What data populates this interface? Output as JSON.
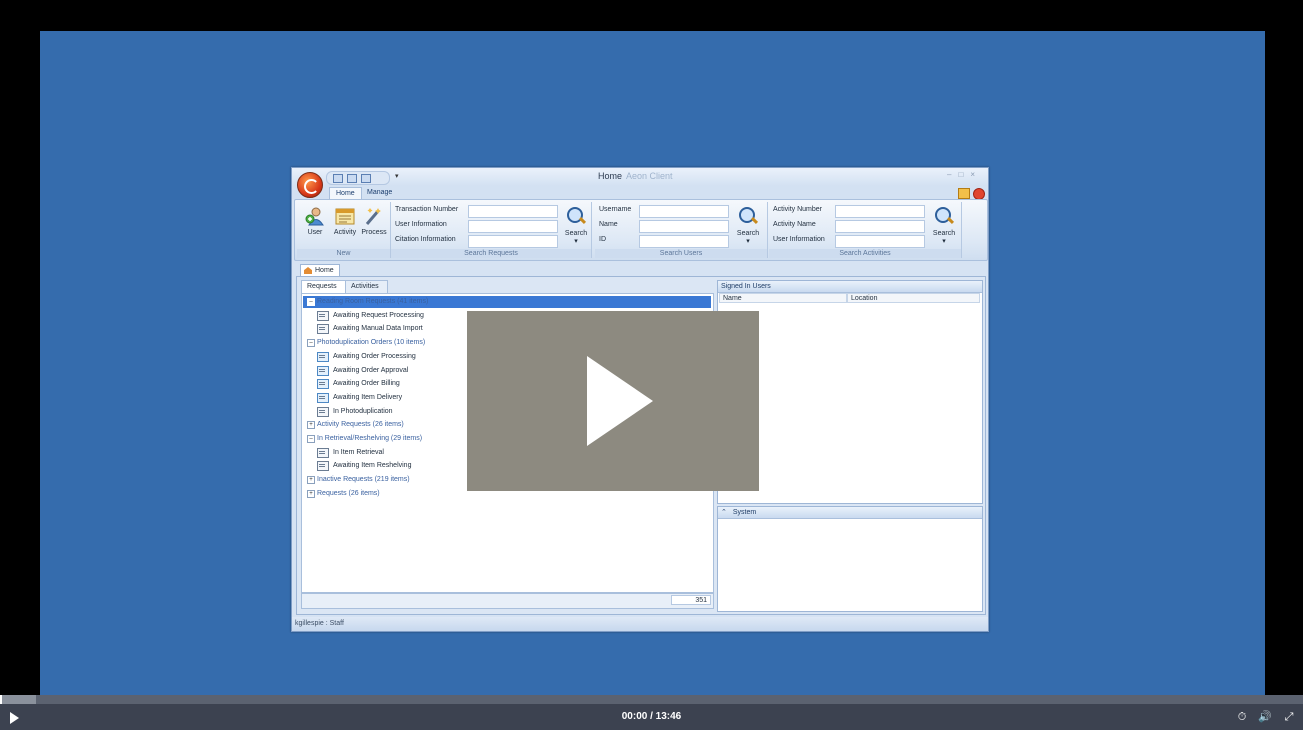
{
  "window": {
    "title": "Home",
    "title_sub": "Aeon Client",
    "ribbon_tabs": [
      "Home",
      "Manage"
    ]
  },
  "ribbon": {
    "new_group": {
      "caption": "New",
      "buttons": [
        "User",
        "Activity",
        "Process"
      ]
    },
    "search_requests": {
      "caption": "Search Requests",
      "fields": [
        "Transaction Number",
        "User Information",
        "Citation Information"
      ],
      "button": "Search"
    },
    "search_users": {
      "caption": "Search Users",
      "fields": [
        "Username",
        "Name",
        "ID"
      ],
      "button": "Search"
    },
    "search_activities": {
      "caption": "Search Activities",
      "fields": [
        "Activity Number",
        "Activity Name",
        "User Information"
      ],
      "button": "Search"
    }
  },
  "doc_tab": "Home",
  "left_tabs": [
    "Requests",
    "Activities"
  ],
  "tree": [
    {
      "label": "Reading Room Requests  (41 items)",
      "type": "group",
      "expanded": true,
      "selected": true
    },
    {
      "label": "Awaiting Request Processing",
      "type": "leaf"
    },
    {
      "label": "Awaiting Manual Data Import",
      "type": "leaf"
    },
    {
      "label": "Photoduplication Orders  (10 items)",
      "type": "group",
      "expanded": true
    },
    {
      "label": "Awaiting Order Processing",
      "type": "photo"
    },
    {
      "label": "Awaiting Order Approval",
      "type": "photo"
    },
    {
      "label": "Awaiting Order Billing",
      "type": "photo"
    },
    {
      "label": "Awaiting Item Delivery",
      "type": "photo"
    },
    {
      "label": "In Photoduplication",
      "type": "leaf"
    },
    {
      "label": "Activity Requests  (26 items)",
      "type": "group",
      "expanded": false
    },
    {
      "label": "In Retrieval/Reshelving  (29 items)",
      "type": "group",
      "expanded": true
    },
    {
      "label": "In Item Retrieval",
      "type": "leaf"
    },
    {
      "label": "Awaiting Item Reshelving",
      "type": "leaf"
    },
    {
      "label": "Inactive Requests  (219 items)",
      "type": "group",
      "expanded": false
    },
    {
      "label": "Requests  (26 items)",
      "type": "group",
      "expanded": false
    }
  ],
  "tree_count": "351",
  "signed_in": {
    "title": "Signed In Users",
    "columns": [
      "Name",
      "Location"
    ]
  },
  "system": {
    "title": "System"
  },
  "status": "kgillespie : Staff",
  "video": {
    "time": "00:00 / 13:46",
    "progress_fraction": 0.0
  }
}
